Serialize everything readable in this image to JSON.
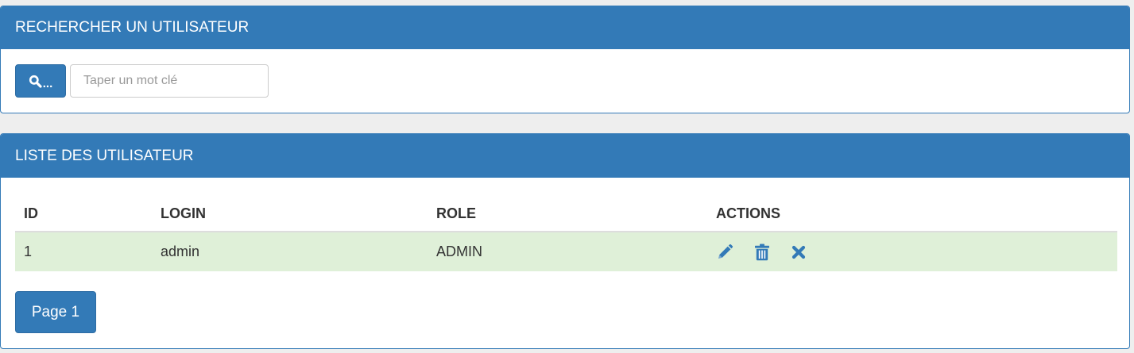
{
  "colors": {
    "primary": "#337ab7",
    "success_row": "#dff0d8",
    "background": "#eeeeee"
  },
  "search_panel": {
    "title": "RECHERCHER UN UTILISATEUR",
    "search_button": {
      "icon": "search-icon",
      "label": "..."
    },
    "input": {
      "value": "",
      "placeholder": "Taper un mot clé"
    }
  },
  "list_panel": {
    "title": "LISTE DES UTILISATEUR",
    "table": {
      "headers": [
        "ID",
        "LOGIN",
        "ROLE",
        "ACTIONS"
      ],
      "rows": [
        {
          "id": "1",
          "login": "admin",
          "role": "ADMIN",
          "actions": [
            "pencil-icon",
            "trash-icon",
            "close-icon"
          ]
        }
      ]
    },
    "pagination": {
      "page_label": "Page 1"
    }
  }
}
